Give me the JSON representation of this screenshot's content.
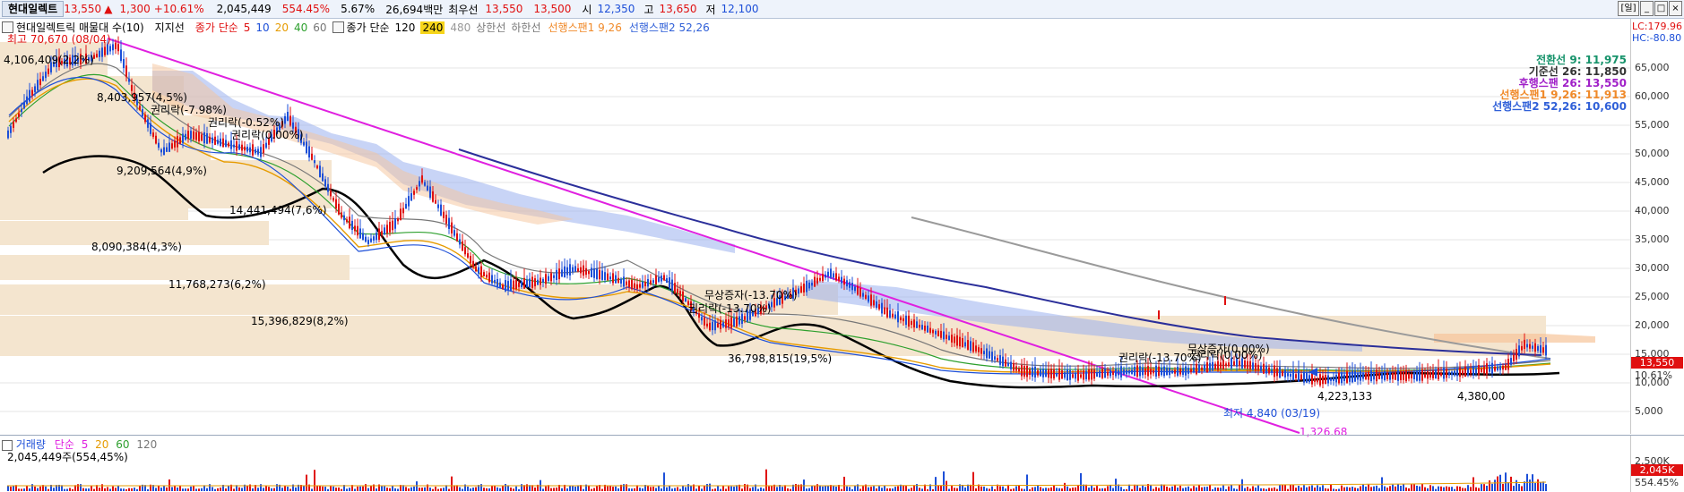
{
  "header": {
    "stock_name": "현대일렉트",
    "price": "13,550",
    "arrow": "▲",
    "change": "1,300",
    "change_pct": "+10.61%",
    "volume": "2,045,449",
    "volume_ratio": "554.45%",
    "turnover": "5.67%",
    "amount": "26,694백만",
    "pref_label": "최우선",
    "best_ask": "13,550",
    "best_bid": "13,500",
    "open_label": "시",
    "open": "12,350",
    "high_label": "고",
    "high": "13,650",
    "low_label": "저",
    "low": "12,100"
  },
  "window": {
    "day_button": "[일]",
    "min_icon": "minimize-icon",
    "max_icon": "maximize-icon",
    "close_icon": "close-icon"
  },
  "legend": {
    "stock_label": "현대일렉트릭 매물대 수(10)",
    "support_label": "지지선",
    "ma_label": "종가 단순",
    "ma_periods": [
      "5",
      "10",
      "20",
      "40",
      "60"
    ],
    "ma2_label": "종가 단순",
    "ma2_periods": [
      "120",
      "240",
      "480"
    ],
    "upper_label": "상한선",
    "lower_label": "하한선",
    "span1_label": "선행스팬1 9,26",
    "span2_label": "선행스팬2 52,26"
  },
  "colors": {
    "up": "#e01010",
    "down": "#1d4fd8",
    "trendline": "#e020e0",
    "ma5": "#e020e0",
    "ma10": "#1d4fd8",
    "ma20": "#e69b00",
    "ma40": "#2ea02e",
    "ma60": "#888888",
    "ma120": "#000000",
    "volume_profile": "#f4e5cf",
    "span1": "#f4a35c",
    "span2": "#6a8fe6"
  },
  "ichimoku": [
    {
      "label": "전환선 9: 11,975",
      "color": "#17936b"
    },
    {
      "label": "기준선 26: 11,850",
      "color": "#333333"
    },
    {
      "label": "후행스팬 26: 13,550",
      "color": "#a020c8"
    },
    {
      "label": "선행스팬1 9,26: 11,913",
      "color": "#f08a2a"
    },
    {
      "label": "선행스팬2 52,26: 10,600",
      "color": "#3060d8"
    }
  ],
  "yaxis": {
    "lc": "LC:179.96",
    "hc": "HC:-80.80",
    "ticks": [
      "65,000",
      "60,000",
      "55,000",
      "50,000",
      "45,000",
      "40,000",
      "35,000",
      "30,000",
      "25,000",
      "20,000",
      "15,000",
      "10,000",
      "5,000"
    ],
    "price_tag": "13,550",
    "pct_tag": "10.61%"
  },
  "annotations": {
    "high_label": "최고 70,670 (08/04)",
    "low_label": "최저 4,840 (03/19)",
    "trend_end": "1,326.68",
    "events": [
      "권리락(-7.98%)",
      "권리락(-0.52%)",
      "권리락(0.00%)",
      "무상증자(-13.70%)",
      "권리락(-13.70%)",
      "권리락(-13.70%)",
      "무상증자(0.00%)",
      "권리락(0.00%)"
    ],
    "bottom_labels": [
      "4,223,133",
      "4,380,00"
    ]
  },
  "volume_profile": [
    {
      "label": "4,106,409(2,2%)"
    },
    {
      "label": "8,403,957(4,5%)"
    },
    {
      "label": "9,209,564(4,9%)"
    },
    {
      "label": "14,441,494(7,6%)"
    },
    {
      "label": "8,090,384(4,3%)"
    },
    {
      "label": "11,768,273(6,2%)"
    },
    {
      "label": "15,396,829(8,2%)"
    },
    {
      "label": "36,798,815(19,5%)"
    }
  ],
  "volume_panel": {
    "legend_label": "거래량",
    "ma_label": "단순",
    "periods": [
      "5",
      "20",
      "60",
      "120"
    ],
    "stat": "2,045,449주(554,45%)",
    "axis_top": "2,500K",
    "tag": "2,045K",
    "tag_pct": "554.45%"
  }
}
